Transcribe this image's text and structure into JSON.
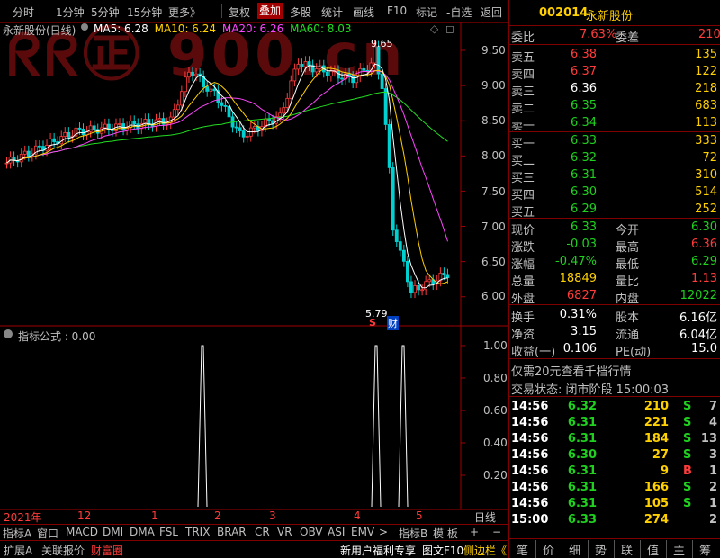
{
  "toolbar": {
    "items": [
      "分时",
      "1分钟",
      "5分钟",
      "15分钟",
      "更多》",
      "复权",
      "叠加",
      "多股",
      "统计",
      "画线",
      "F10",
      "标记",
      "-自选",
      "返回"
    ]
  },
  "watermark": "ᖇᖇ㊣ 900.cn",
  "main_chart": {
    "title": "永新股份(日线)",
    "legend": [
      {
        "label": "MA5: 6.28",
        "color": "#ffffff"
      },
      {
        "label": "MA10: 6.24",
        "color": "#ffd000"
      },
      {
        "label": "MA20: 6.26",
        "color": "#ff44ff"
      },
      {
        "label": "MA60: 8.03",
        "color": "#22dd22"
      }
    ],
    "high_label": "9.65",
    "low_label": "5.79",
    "marker_s": "S",
    "marker_cai": "财",
    "y_ticks": [
      "9.50",
      "9.00",
      "8.50",
      "8.00",
      "7.50",
      "7.00",
      "6.50",
      "6.00"
    ]
  },
  "indicator": {
    "title": "指标公式 : 0.00",
    "y_ticks": [
      "1.00",
      "0.80",
      "0.60",
      "0.40",
      "0.20"
    ]
  },
  "x_axis": {
    "labels": [
      "2021年",
      "12",
      "1",
      "2",
      "3",
      "4",
      "5"
    ],
    "period": "日线"
  },
  "tabs": [
    "指标A",
    "窗口",
    "MACD",
    "DMI",
    "DMA",
    "FSL",
    "TRIX",
    "BRAR",
    "CR",
    "VR",
    "OBV",
    "ASI",
    "EMV",
    ">",
    "指标B",
    "模 板",
    "+",
    "−"
  ],
  "bottom_left": [
    "扩展A",
    "关联报价",
    "财富圈"
  ],
  "bottom_mid": [
    "新用户福利专享",
    "图文F10",
    "侧边栏《"
  ],
  "bottom_right": [
    "笔",
    "价",
    "细",
    "势",
    "联",
    "值",
    "主",
    "筹"
  ],
  "stock": {
    "code": "002014",
    "name": "永新股份"
  },
  "weibi": {
    "label1": "委比",
    "value1": "7.63%",
    "label2": "委差",
    "value2": "210"
  },
  "sell": [
    {
      "label": "卖五",
      "price": "6.38",
      "vol": "135"
    },
    {
      "label": "卖四",
      "price": "6.37",
      "vol": "122"
    },
    {
      "label": "卖三",
      "price": "6.36",
      "vol": "218"
    },
    {
      "label": "卖二",
      "price": "6.35",
      "vol": "683"
    },
    {
      "label": "卖一",
      "price": "6.34",
      "vol": "113"
    }
  ],
  "buy": [
    {
      "label": "买一",
      "price": "6.33",
      "vol": "333"
    },
    {
      "label": "买二",
      "price": "6.32",
      "vol": "72"
    },
    {
      "label": "买三",
      "price": "6.31",
      "vol": "310"
    },
    {
      "label": "买四",
      "price": "6.30",
      "vol": "514"
    },
    {
      "label": "买五",
      "price": "6.29",
      "vol": "252"
    }
  ],
  "quote": [
    {
      "l1": "现价",
      "v1": "6.33",
      "l2": "今开",
      "v2": "6.30"
    },
    {
      "l1": "涨跌",
      "v1": "-0.03",
      "l2": "最高",
      "v2": "6.36"
    },
    {
      "l1": "涨幅",
      "v1": "-0.47%",
      "l2": "最低",
      "v2": "6.29"
    },
    {
      "l1": "总量",
      "v1": "18849",
      "l2": "量比",
      "v2": "1.13"
    },
    {
      "l1": "外盘",
      "v1": "6827",
      "l2": "内盘",
      "v2": "12022"
    }
  ],
  "stats": [
    {
      "l1": "换手",
      "v1": "0.31%",
      "l2": "股本",
      "v2": "6.16亿"
    },
    {
      "l1": "净资",
      "v1": "3.15",
      "l2": "流通",
      "v2": "6.04亿"
    },
    {
      "l1": "收益(一)",
      "v1": "0.106",
      "l2": "PE(动)",
      "v2": "15.0"
    }
  ],
  "promo": "仅需20元查看千档行情",
  "trade_status": "交易状态: 闭市阶段 15:00:03",
  "ticks": [
    {
      "time": "14:56",
      "price": "6.32",
      "vol": "210",
      "side": "S",
      "n": "7"
    },
    {
      "time": "14:56",
      "price": "6.31",
      "vol": "221",
      "side": "S",
      "n": "4"
    },
    {
      "time": "14:56",
      "price": "6.31",
      "vol": "184",
      "side": "S",
      "n": "13"
    },
    {
      "time": "14:56",
      "price": "6.30",
      "vol": "27",
      "side": "S",
      "n": "3"
    },
    {
      "time": "14:56",
      "price": "6.31",
      "vol": "9",
      "side": "B",
      "n": "1"
    },
    {
      "time": "14:56",
      "price": "6.31",
      "vol": "166",
      "side": "S",
      "n": "2"
    },
    {
      "time": "14:56",
      "price": "6.31",
      "vol": "105",
      "side": "S",
      "n": "1"
    },
    {
      "time": "15:00",
      "price": "6.33",
      "vol": "274",
      "side": "",
      "n": "2"
    }
  ]
}
